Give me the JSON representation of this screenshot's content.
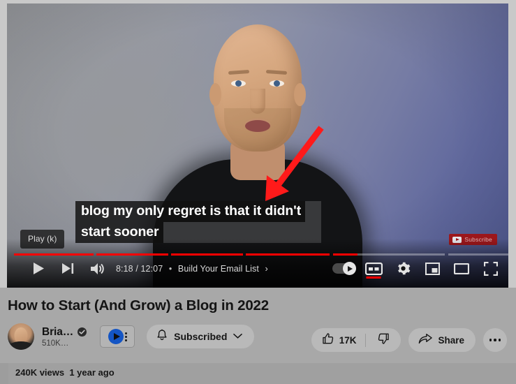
{
  "player": {
    "tooltip": "Play (k)",
    "caption_lines": [
      "blog my only regret is that it didn't",
      "start sooner"
    ],
    "watermark": {
      "label": "Subscribe",
      "icon": "youtube-logo-icon",
      "color": "#a31212"
    },
    "annotation": {
      "type": "arrow",
      "color": "#ff1a1a"
    },
    "controls": {
      "play_icon": "play-icon",
      "next_icon": "next-track-icon",
      "volume_icon": "volume-on-icon",
      "time_current": "8:18",
      "time_separator": "/",
      "time_total": "12:07",
      "chapter_separator": "•",
      "chapter_title": "Build Your Email List",
      "chapter_chevron": "›",
      "autoplay_icon": "autoplay-toggle-icon",
      "captions_icon": "closed-captions-icon",
      "settings_icon": "gear-icon",
      "miniplayer_icon": "miniplayer-icon",
      "theater_icon": "theater-mode-icon",
      "fullscreen_icon": "fullscreen-icon",
      "captions_active": true
    },
    "progress": {
      "played_color": "#ff0000",
      "buffer_color": "#ffffff",
      "percent": 68.5,
      "chapters": [
        {
          "left_pct": 0.0,
          "width_pct": 15.9
        },
        {
          "left_pct": 16.5,
          "width_pct": 14.3
        },
        {
          "left_pct": 31.4,
          "width_pct": 14.3
        },
        {
          "left_pct": 46.3,
          "width_pct": 16.7
        },
        {
          "left_pct": 63.6,
          "width_pct": 22.4
        },
        {
          "left_pct": 86.6,
          "width_pct": 13.4
        }
      ]
    }
  },
  "meta": {
    "title": "How to Start (And Grow) a Blog in 2022",
    "owner": {
      "name": "Bria…",
      "subscribers": "510K…",
      "verified_icon": "verified-check-icon",
      "avatar_icon": "channel-avatar"
    },
    "notification": {
      "icon": "notification-play-icon",
      "menu_icon": "kebab-menu-icon"
    },
    "subscribe": {
      "label": "Subscribed",
      "bell_icon": "bell-icon",
      "chevron_icon": "chevron-down-icon"
    },
    "actions": {
      "like_icon": "thumbs-up-icon",
      "like_count": "17K",
      "dislike_icon": "thumbs-down-icon",
      "share_icon": "share-arrow-icon",
      "share_label": "Share",
      "more_icon": "more-horizontal-icon"
    },
    "stats": {
      "views": "240K views",
      "published": "1 year ago"
    }
  }
}
